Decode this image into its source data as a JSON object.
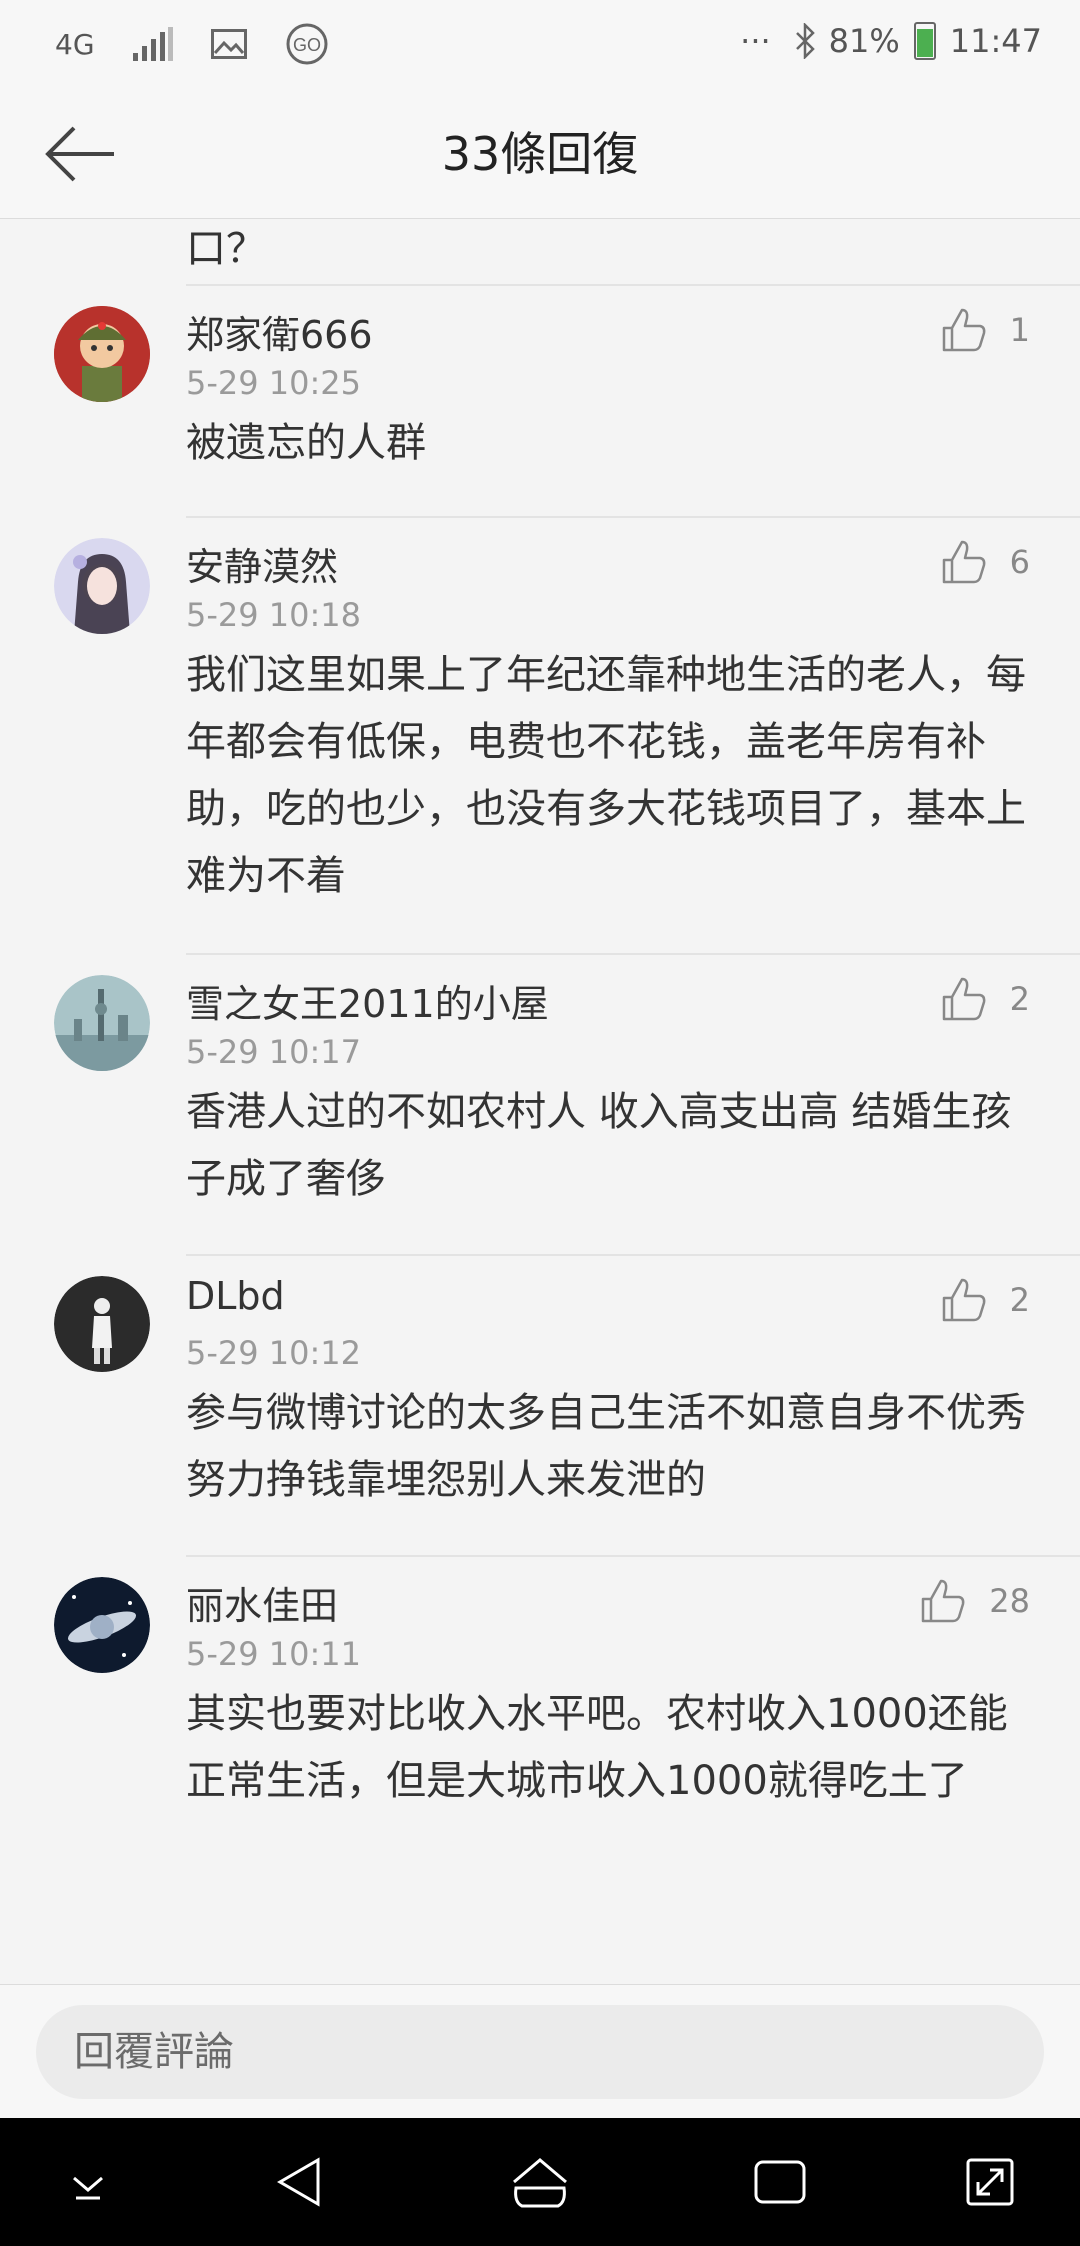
{
  "status_bar": {
    "network": "4G",
    "battery": "81%",
    "battery_level": 0.81,
    "time": "11:47",
    "dots": "···"
  },
  "header": {
    "title": "33條回復"
  },
  "truncated_text": "口？",
  "comments": [
    {
      "username": "郑家衛666",
      "time": "5-29 10:25",
      "text": "被遗忘的人群",
      "likes": "1"
    },
    {
      "username": "安静漠然",
      "time": "5-29 10:18",
      "text": "我们这里如果上了年纪还靠种地生活的老人，每年都会有低保，电费也不花钱，盖老年房有补助，吃的也少，也没有多大花钱项目了，基本上难为不着",
      "likes": "6"
    },
    {
      "username": "雪之女王2011的小屋",
      "time": "5-29 10:17",
      "text": "香港人过的不如农村人 收入高支出高 结婚生孩子成了奢侈",
      "likes": "2"
    },
    {
      "username": "DLbd",
      "time": "5-29 10:12",
      "text": "参与微博讨论的太多自己生活不如意自身不优秀努力挣钱靠埋怨别人来发泄的",
      "likes": "2"
    },
    {
      "username": "丽水佳田",
      "time": "5-29 10:11",
      "text": "其实也要对比收入水平吧。农村收入1000还能正常生活，但是大城市收入1000就得吃土了",
      "likes": "28"
    }
  ],
  "reply": {
    "placeholder": "回覆評論"
  }
}
